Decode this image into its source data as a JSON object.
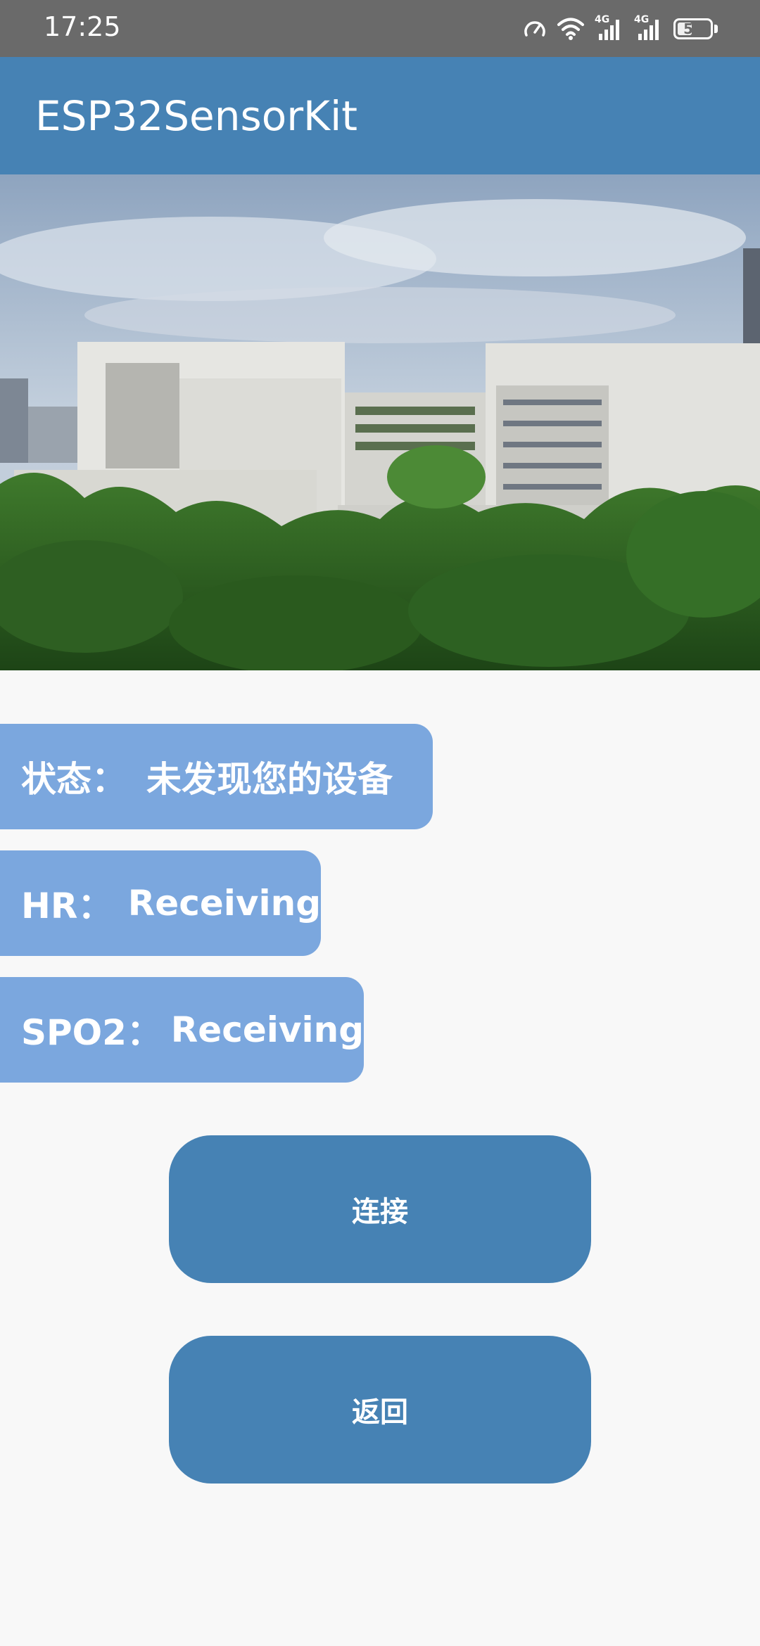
{
  "status_bar": {
    "time": "17:25",
    "network_1": "4G",
    "network_2": "4G",
    "battery_percent": "51",
    "battery_level": 0.51
  },
  "app_bar": {
    "title": "ESP32SensorKit"
  },
  "hero": {
    "image_subject": "campus-building-photo"
  },
  "info": {
    "status_label": "状态：",
    "status_value": "未发现您的设备",
    "hr_label": "HR：",
    "hr_value": "Receiving",
    "spo2_label": "SPO2：",
    "spo2_value": "Receiving"
  },
  "buttons": {
    "connect_label": "连接",
    "back_label": "返回"
  },
  "colors": {
    "primary": "#4682b4",
    "pill": "#7ba7de",
    "status_bar": "#6a6a6a",
    "background": "#f8f8f8"
  }
}
